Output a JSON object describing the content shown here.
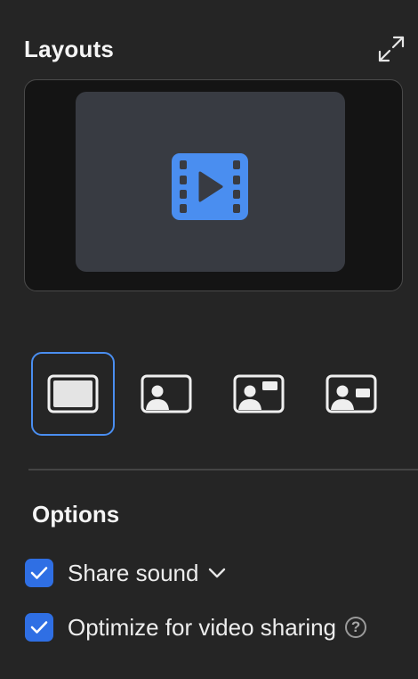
{
  "header": {
    "title": "Layouts",
    "expand_icon": "expand-arrows-icon"
  },
  "preview": {
    "icon": "video-file-icon",
    "accent_color": "#4a8ef0"
  },
  "layouts": [
    {
      "name": "content-only",
      "icon": "content-only-layout-icon",
      "selected": true
    },
    {
      "name": "person-only",
      "icon": "person-layout-icon",
      "selected": false
    },
    {
      "name": "person-with-top-content",
      "icon": "person-top-content-layout-icon",
      "selected": false
    },
    {
      "name": "person-with-side-content",
      "icon": "person-side-content-layout-icon",
      "selected": false
    }
  ],
  "options": {
    "title": "Options",
    "share_sound": {
      "label": "Share sound",
      "checked": true,
      "icon": "chevron-down-icon"
    },
    "optimize_video": {
      "label": "Optimize for video sharing",
      "checked": true,
      "help_glyph": "?"
    }
  },
  "colors": {
    "background": "#252525",
    "checkbox": "#2f6fe4",
    "selection": "#4a8ef0"
  }
}
